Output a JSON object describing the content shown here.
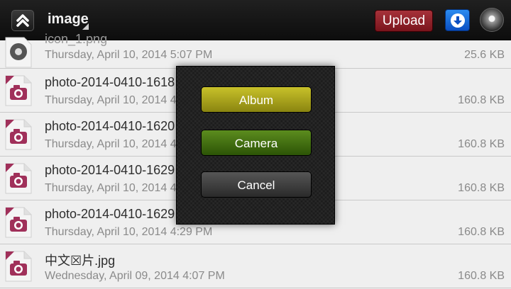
{
  "header": {
    "folder_title": "image",
    "upload_label": "Upload"
  },
  "icons": {
    "up": "chevron-up-icon",
    "download": "download-icon",
    "settings": "settings-knob-icon",
    "image_file": "jpeg-camera-file-icon",
    "settings_file": "gear-file-icon"
  },
  "files": [
    {
      "name": "icon_1.png",
      "date": "Thursday, April 10, 2014 5:07 PM",
      "size": "25.6 KB",
      "icon": "gear-file-icon"
    },
    {
      "name": "photo-2014-0410-1618",
      "date": "Thursday, April 10, 2014 4",
      "size": "160.8 KB",
      "icon": "jpeg-camera-file-icon"
    },
    {
      "name": "photo-2014-0410-1620",
      "date": "Thursday, April 10, 2014 4",
      "size": "160.8 KB",
      "icon": "jpeg-camera-file-icon"
    },
    {
      "name": "photo-2014-0410-1629",
      "date": "Thursday, April 10, 2014 4",
      "size": "160.8 KB",
      "icon": "jpeg-camera-file-icon"
    },
    {
      "name": "photo-2014-0410-1629",
      "date": "Thursday, April 10, 2014 4:29 PM",
      "size": "160.8 KB",
      "icon": "jpeg-camera-file-icon"
    },
    {
      "name": "中文☒片.jpg",
      "date": "Wednesday, April 09, 2014 4:07 PM",
      "size": "160.8 KB",
      "icon": "jpeg-camera-file-icon"
    }
  ],
  "dialog": {
    "album_label": "Album",
    "camera_label": "Camera",
    "cancel_label": "Cancel"
  },
  "colors": {
    "upload": "#8c1e26",
    "download": "#1a6fe0",
    "album": "#aaa31e",
    "camera": "#44701a",
    "cancel": "#3e3e3e"
  }
}
